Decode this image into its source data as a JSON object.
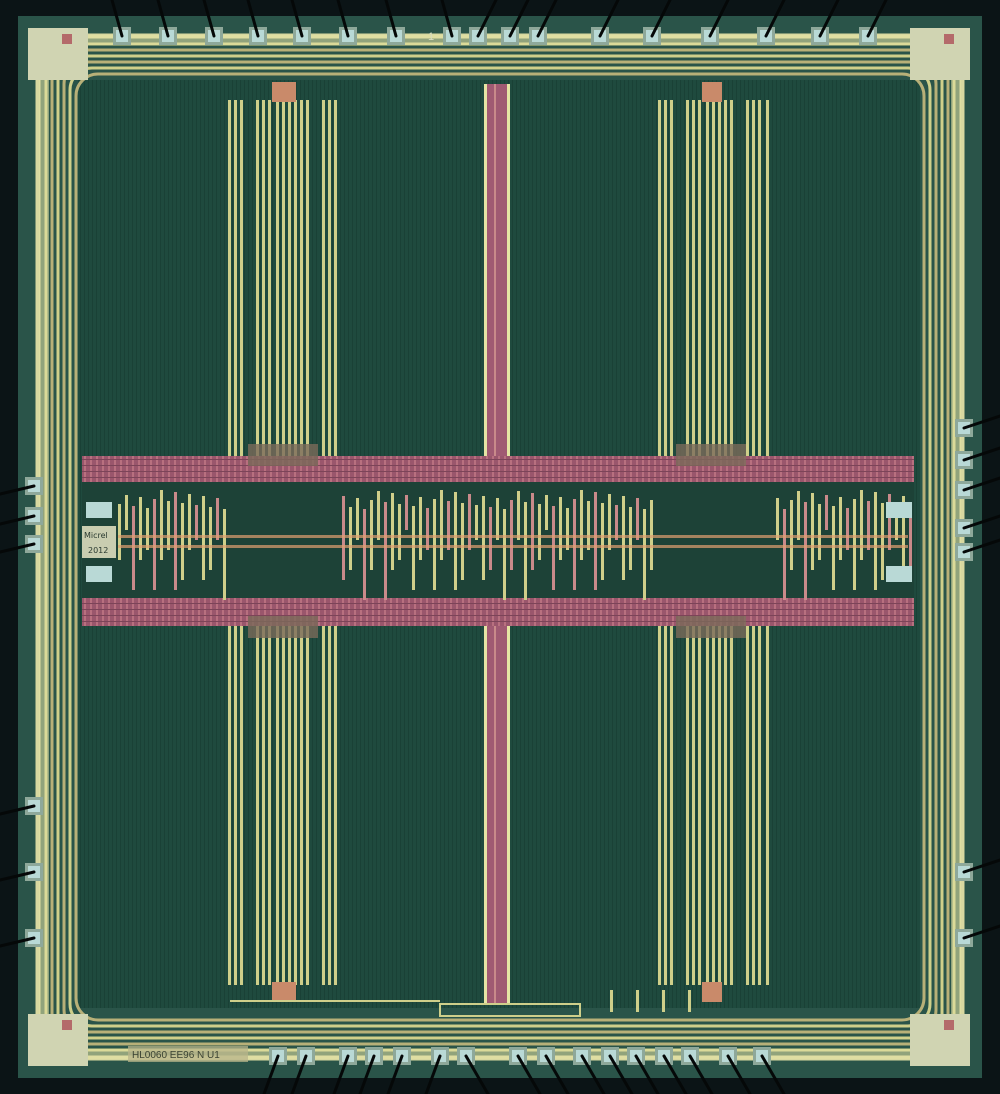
{
  "image": {
    "subject": "die micrograph",
    "colors": {
      "background": "#0b1416",
      "substrate": "#1f4a3e",
      "substrate_dark": "#173a31",
      "metal": "#cfcf8a",
      "metal_bright": "#e6e4a4",
      "logic": "#a05a72",
      "logic_light": "#c98a8a",
      "pad": "#b9d9d6",
      "bondwire": "#050808"
    }
  },
  "markings": {
    "corner_label": "1",
    "die_label_bottom": "HL0060 EE96 N U1",
    "logo_brand": "Micrel",
    "logo_year": "2012"
  }
}
